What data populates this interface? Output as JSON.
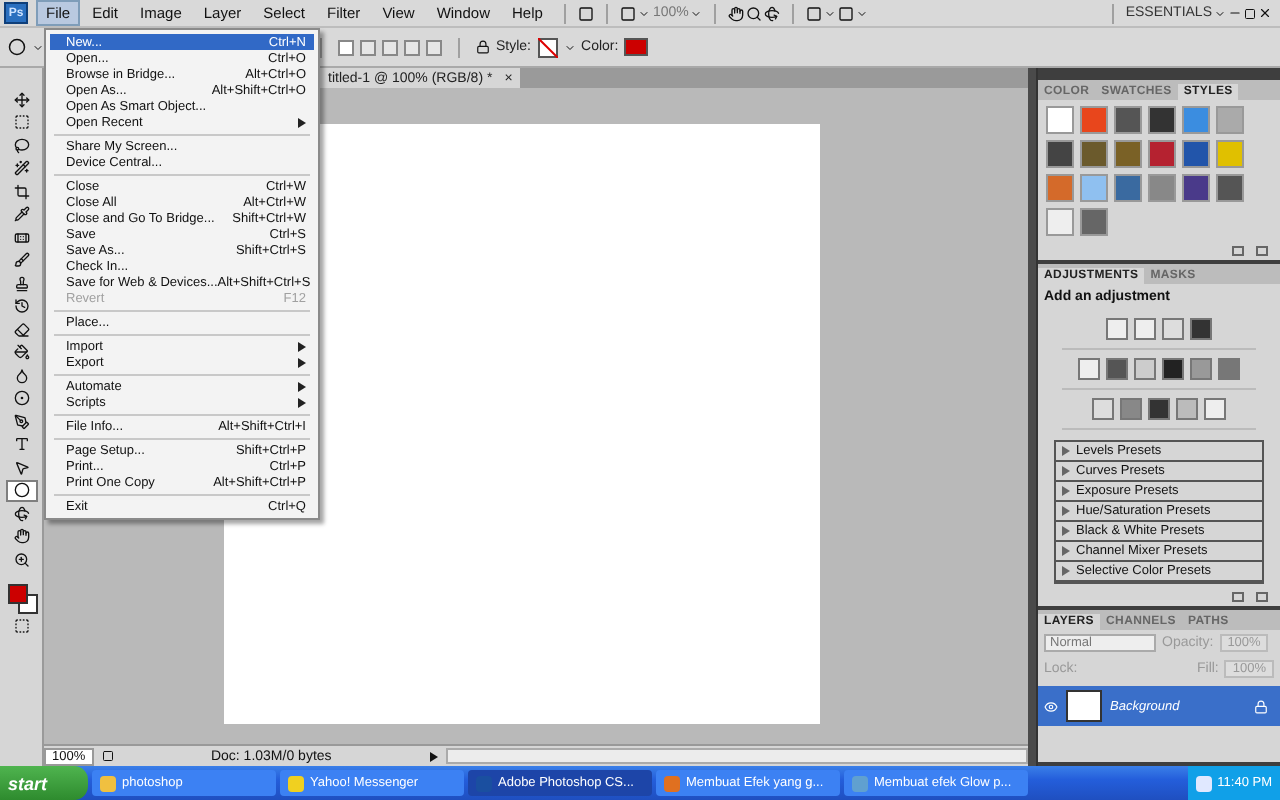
{
  "menubar": {
    "logo": "Ps",
    "items": [
      {
        "label": "File",
        "selected": true
      },
      {
        "label": "Edit",
        "selected": false
      },
      {
        "label": "Image",
        "selected": false
      },
      {
        "label": "Layer",
        "selected": false
      },
      {
        "label": "Select",
        "selected": false
      },
      {
        "label": "Filter",
        "selected": false
      },
      {
        "label": "View",
        "selected": false
      },
      {
        "label": "Window",
        "selected": false
      },
      {
        "label": "Help",
        "selected": false
      }
    ],
    "zoom": "100%",
    "workspace": "ESSENTIALS"
  },
  "options_bar": {
    "style_label": "Style:",
    "color_label": "Color:"
  },
  "document_tab": {
    "title": "titled-1 @ 100% (RGB/8) *",
    "close": "×"
  },
  "file_menu": [
    {
      "kind": "item",
      "label": "New...",
      "shortcut": "Ctrl+N",
      "selected": true,
      "disabled": false,
      "submenu": false
    },
    {
      "kind": "item",
      "label": "Open...",
      "shortcut": "Ctrl+O",
      "selected": false,
      "disabled": false,
      "submenu": false
    },
    {
      "kind": "item",
      "label": "Browse in Bridge...",
      "shortcut": "Alt+Ctrl+O",
      "selected": false,
      "disabled": false,
      "submenu": false
    },
    {
      "kind": "item",
      "label": "Open As...",
      "shortcut": "Alt+Shift+Ctrl+O",
      "selected": false,
      "disabled": false,
      "submenu": false
    },
    {
      "kind": "item",
      "label": "Open As Smart Object...",
      "selected": false,
      "disabled": false,
      "submenu": false
    },
    {
      "kind": "item",
      "label": "Open Recent",
      "selected": false,
      "disabled": false,
      "submenu": true
    },
    {
      "kind": "separator"
    },
    {
      "kind": "item",
      "label": "Share My Screen...",
      "selected": false,
      "disabled": false,
      "submenu": false
    },
    {
      "kind": "item",
      "label": "Device Central...",
      "selected": false,
      "disabled": false,
      "submenu": false
    },
    {
      "kind": "separator"
    },
    {
      "kind": "item",
      "label": "Close",
      "shortcut": "Ctrl+W",
      "selected": false,
      "disabled": false,
      "submenu": false
    },
    {
      "kind": "item",
      "label": "Close All",
      "shortcut": "Alt+Ctrl+W",
      "selected": false,
      "disabled": false,
      "submenu": false
    },
    {
      "kind": "item",
      "label": "Close and Go To Bridge...",
      "shortcut": "Shift+Ctrl+W",
      "selected": false,
      "disabled": false,
      "submenu": false
    },
    {
      "kind": "item",
      "label": "Save",
      "shortcut": "Ctrl+S",
      "selected": false,
      "disabled": false,
      "submenu": false
    },
    {
      "kind": "item",
      "label": "Save As...",
      "shortcut": "Shift+Ctrl+S",
      "selected": false,
      "disabled": false,
      "submenu": false
    },
    {
      "kind": "item",
      "label": "Check In...",
      "selected": false,
      "disabled": false,
      "submenu": false
    },
    {
      "kind": "item",
      "label": "Save for Web & Devices...",
      "shortcut": "Alt+Shift+Ctrl+S",
      "selected": false,
      "disabled": false,
      "submenu": false
    },
    {
      "kind": "item",
      "label": "Revert",
      "shortcut": "F12",
      "selected": false,
      "disabled": true,
      "submenu": false
    },
    {
      "kind": "separator"
    },
    {
      "kind": "item",
      "label": "Place...",
      "selected": false,
      "disabled": false,
      "submenu": false
    },
    {
      "kind": "separator"
    },
    {
      "kind": "item",
      "label": "Import",
      "selected": false,
      "disabled": false,
      "submenu": true
    },
    {
      "kind": "item",
      "label": "Export",
      "selected": false,
      "disabled": false,
      "submenu": true
    },
    {
      "kind": "separator"
    },
    {
      "kind": "item",
      "label": "Automate",
      "selected": false,
      "disabled": false,
      "submenu": true
    },
    {
      "kind": "item",
      "label": "Scripts",
      "selected": false,
      "disabled": false,
      "submenu": true
    },
    {
      "kind": "separator"
    },
    {
      "kind": "item",
      "label": "File Info...",
      "shortcut": "Alt+Shift+Ctrl+I",
      "selected": false,
      "disabled": false,
      "submenu": false
    },
    {
      "kind": "separator"
    },
    {
      "kind": "item",
      "label": "Page Setup...",
      "shortcut": "Shift+Ctrl+P",
      "selected": false,
      "disabled": false,
      "submenu": false
    },
    {
      "kind": "item",
      "label": "Print...",
      "shortcut": "Ctrl+P",
      "selected": false,
      "disabled": false,
      "submenu": false
    },
    {
      "kind": "item",
      "label": "Print One Copy",
      "shortcut": "Alt+Shift+Ctrl+P",
      "selected": false,
      "disabled": false,
      "submenu": false
    },
    {
      "kind": "separator"
    },
    {
      "kind": "item",
      "label": "Exit",
      "shortcut": "Ctrl+Q",
      "selected": false,
      "disabled": false,
      "submenu": false
    }
  ],
  "toolbox": {
    "tools": [
      {
        "selected": false
      },
      {
        "selected": false
      },
      {
        "selected": false
      },
      {
        "selected": false
      },
      {
        "selected": false
      },
      {
        "selected": false
      },
      {
        "selected": false
      },
      {
        "selected": false
      },
      {
        "selected": false
      },
      {
        "selected": false
      },
      {
        "selected": false
      },
      {
        "selected": false
      },
      {
        "selected": false
      },
      {
        "selected": false
      },
      {
        "selected": false
      },
      {
        "selected": false
      },
      {
        "selected": false
      },
      {
        "selected": true
      },
      {
        "selected": false
      },
      {
        "selected": false
      },
      {
        "selected": false
      }
    ]
  },
  "status_bar": {
    "zoom": "100%",
    "doc_info": "Doc: 1.03M/0 bytes"
  },
  "styles_panel": {
    "tabs": [
      {
        "label": "COLOR",
        "selected": false
      },
      {
        "label": "SWATCHES",
        "selected": false
      },
      {
        "label": "STYLES",
        "selected": true
      }
    ]
  },
  "adjustments_panel": {
    "tabs": [
      {
        "label": "ADJUSTMENTS",
        "selected": true
      },
      {
        "label": "MASKS",
        "selected": false
      }
    ],
    "heading": "Add an adjustment",
    "presets": [
      "Levels Presets",
      "Curves Presets",
      "Exposure Presets",
      "Hue/Saturation Presets",
      "Black & White Presets",
      "Channel Mixer Presets",
      "Selective Color Presets"
    ]
  },
  "layers_panel": {
    "tabs": [
      {
        "label": "LAYERS",
        "selected": true
      },
      {
        "label": "CHANNELS",
        "selected": false
      },
      {
        "label": "PATHS",
        "selected": false
      }
    ],
    "blend_mode": "Normal",
    "opacity_label": "Opacity:",
    "opacity": "100%",
    "lock_label": "Lock:",
    "fill_label": "Fill:",
    "fill": "100%",
    "layers": [
      {
        "name": "Background",
        "selected": true,
        "visible": true,
        "locked": true
      }
    ]
  },
  "taskbar": {
    "start": "start",
    "items": [
      {
        "label": "photoshop",
        "selected": false
      },
      {
        "label": "Yahoo! Messenger",
        "selected": false
      },
      {
        "label": "Adobe Photoshop CS...",
        "selected": true
      },
      {
        "label": "Membuat Efek yang g...",
        "selected": false
      },
      {
        "label": "Membuat efek Glow p...",
        "selected": false
      }
    ],
    "clock": "11:40 PM"
  }
}
